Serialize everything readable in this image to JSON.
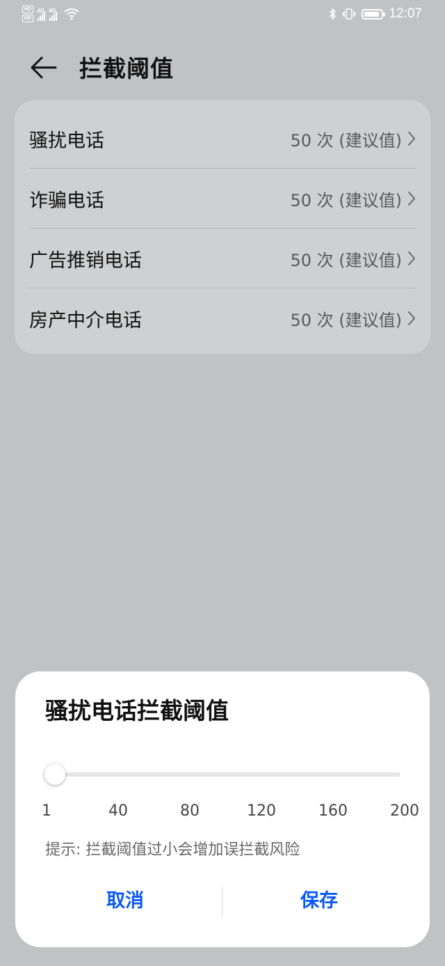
{
  "status_bar": {
    "hd_badges": [
      "HD",
      "HD"
    ],
    "network_1": "4G",
    "network_2": "4G",
    "clock": "12:07",
    "icons": [
      "bluetooth-icon",
      "vibrate-icon",
      "battery-icon"
    ]
  },
  "header": {
    "title": "拦截阈值",
    "back_icon": "arrow-left-icon"
  },
  "settings": {
    "items": [
      {
        "label": "骚扰电话",
        "value": "50 次 (建议值)"
      },
      {
        "label": "诈骗电话",
        "value": "50 次 (建议值)"
      },
      {
        "label": "广告推销电话",
        "value": "50 次 (建议值)"
      },
      {
        "label": "房产中介电话",
        "value": "50 次 (建议值)"
      }
    ]
  },
  "dialog": {
    "title": "骚扰电话拦截阈值",
    "slider": {
      "min": 1,
      "max": 200,
      "value": 1
    },
    "scale_labels": [
      "1",
      "40",
      "80",
      "120",
      "160",
      "200"
    ],
    "hint": "提示: 拦截阈值过小会增加误拦截风险",
    "cancel_label": "取消",
    "save_label": "保存"
  },
  "colors": {
    "accent": "#0a59f7",
    "scrim_background": "#c1c2c4",
    "card_background": "#cfd0d1",
    "dialog_background": "#ffffff"
  }
}
